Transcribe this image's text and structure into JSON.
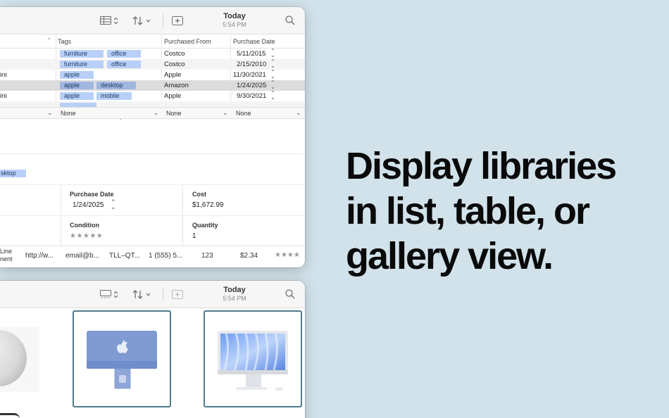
{
  "headline": {
    "line1": "Display libraries",
    "line2": "in list, table, or",
    "line3": "gallery view."
  },
  "top_window": {
    "toolbar": {
      "date_title": "Today",
      "date_subtitle": "5:54 PM",
      "icons": [
        "table-view-icon",
        "sort-icon",
        "add-item-icon",
        "search-icon"
      ]
    },
    "columns": {
      "tags": "Tags",
      "purchased_from": "Purchased From",
      "purchase_date": "Purchase Date"
    },
    "rows": [
      {
        "name": "",
        "tags": [
          "furniture",
          "office"
        ],
        "from": "Costco",
        "date": "5/11/2015"
      },
      {
        "name": "",
        "tags": [
          "furniture",
          "office"
        ],
        "from": "Costco",
        "date": "2/15/2010"
      },
      {
        "name": "ini",
        "tags": [
          "apple"
        ],
        "from": "Apple",
        "date": "11/30/2021"
      },
      {
        "name": "",
        "tags": [
          "apple",
          "desktop"
        ],
        "from": "Amazon",
        "date": "1/24/2025"
      },
      {
        "name": "ini",
        "tags": [
          "apple",
          "mobile"
        ],
        "from": "Apple",
        "date": "9/30/2021"
      }
    ],
    "filters": [
      "None",
      "None",
      "None"
    ],
    "detail": {
      "tag_fragment": "sktop",
      "purchase_date_label": "Purchase Date",
      "purchase_date_value": "1/24/2025",
      "cost_label": "Cost",
      "cost_value": "$1,672.99",
      "condition_label": "Condition",
      "condition_stars": "★★★★★",
      "quantity_label": "Quantity",
      "quantity_value": "1"
    },
    "strip": {
      "line_1": "Line",
      "line_2": "nent",
      "url": "http://w...",
      "email": "email@b...",
      "code": "TLL–QT...",
      "phone": "1 (555) 5...",
      "number": "123",
      "price": "$2.34",
      "stars": "★★★★"
    }
  },
  "bottom_window": {
    "toolbar": {
      "date_title": "Today",
      "date_subtitle": "5:54 PM",
      "icons": [
        "gallery-view-icon",
        "sort-icon",
        "add-item-icon",
        "search-icon"
      ]
    },
    "items": [
      "homepod-mini",
      "imac-blue",
      "imac-silver"
    ]
  },
  "colors": {
    "background": "#d2e2ea",
    "tag": "#b8cff7",
    "gallery_border": "#4f7b8a"
  }
}
